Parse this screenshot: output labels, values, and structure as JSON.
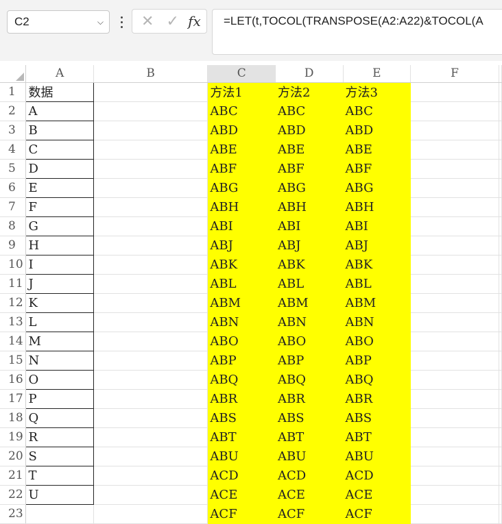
{
  "formula_bar": {
    "name_box": "C2",
    "name_box_caret": "⌵",
    "cancel_glyph": "✕",
    "enter_glyph": "✓",
    "function_glyph": "fx",
    "formula": "=LET(t,TOCOL(TRANSPOSE(A2:A22)&TOCOL(A"
  },
  "columns": [
    "A",
    "B",
    "C",
    "D",
    "E",
    "F"
  ],
  "rows": [
    {
      "n": "1",
      "a": "数据",
      "c": "方法1",
      "d": "方法2",
      "e": "方法3"
    },
    {
      "n": "2",
      "a": "A",
      "c": "ABC",
      "d": "ABC",
      "e": "ABC"
    },
    {
      "n": "3",
      "a": "B",
      "c": "ABD",
      "d": "ABD",
      "e": "ABD"
    },
    {
      "n": "4",
      "a": "C",
      "c": "ABE",
      "d": "ABE",
      "e": "ABE"
    },
    {
      "n": "5",
      "a": "D",
      "c": "ABF",
      "d": "ABF",
      "e": "ABF"
    },
    {
      "n": "6",
      "a": "E",
      "c": "ABG",
      "d": "ABG",
      "e": "ABG"
    },
    {
      "n": "7",
      "a": "F",
      "c": "ABH",
      "d": "ABH",
      "e": "ABH"
    },
    {
      "n": "8",
      "a": "G",
      "c": "ABI",
      "d": "ABI",
      "e": "ABI"
    },
    {
      "n": "9",
      "a": "H",
      "c": "ABJ",
      "d": "ABJ",
      "e": "ABJ"
    },
    {
      "n": "10",
      "a": "I",
      "c": "ABK",
      "d": "ABK",
      "e": "ABK"
    },
    {
      "n": "11",
      "a": "J",
      "c": "ABL",
      "d": "ABL",
      "e": "ABL"
    },
    {
      "n": "12",
      "a": "K",
      "c": "ABM",
      "d": "ABM",
      "e": "ABM"
    },
    {
      "n": "13",
      "a": "L",
      "c": "ABN",
      "d": "ABN",
      "e": "ABN"
    },
    {
      "n": "14",
      "a": "M",
      "c": "ABO",
      "d": "ABO",
      "e": "ABO"
    },
    {
      "n": "15",
      "a": "N",
      "c": "ABP",
      "d": "ABP",
      "e": "ABP"
    },
    {
      "n": "16",
      "a": "O",
      "c": "ABQ",
      "d": "ABQ",
      "e": "ABQ"
    },
    {
      "n": "17",
      "a": "P",
      "c": "ABR",
      "d": "ABR",
      "e": "ABR"
    },
    {
      "n": "18",
      "a": "Q",
      "c": "ABS",
      "d": "ABS",
      "e": "ABS"
    },
    {
      "n": "19",
      "a": "R",
      "c": "ABT",
      "d": "ABT",
      "e": "ABT"
    },
    {
      "n": "20",
      "a": "S",
      "c": "ABU",
      "d": "ABU",
      "e": "ABU"
    },
    {
      "n": "21",
      "a": "T",
      "c": "ACD",
      "d": "ACD",
      "e": "ACD"
    },
    {
      "n": "22",
      "a": "U",
      "c": "ACE",
      "d": "ACE",
      "e": "ACE"
    },
    {
      "n": "23",
      "a": "",
      "c": "ACF",
      "d": "ACF",
      "e": "ACF"
    }
  ],
  "colors": {
    "highlight": "#ffff00",
    "grid_line": "#e1e1e1",
    "data_border": "#222222"
  }
}
